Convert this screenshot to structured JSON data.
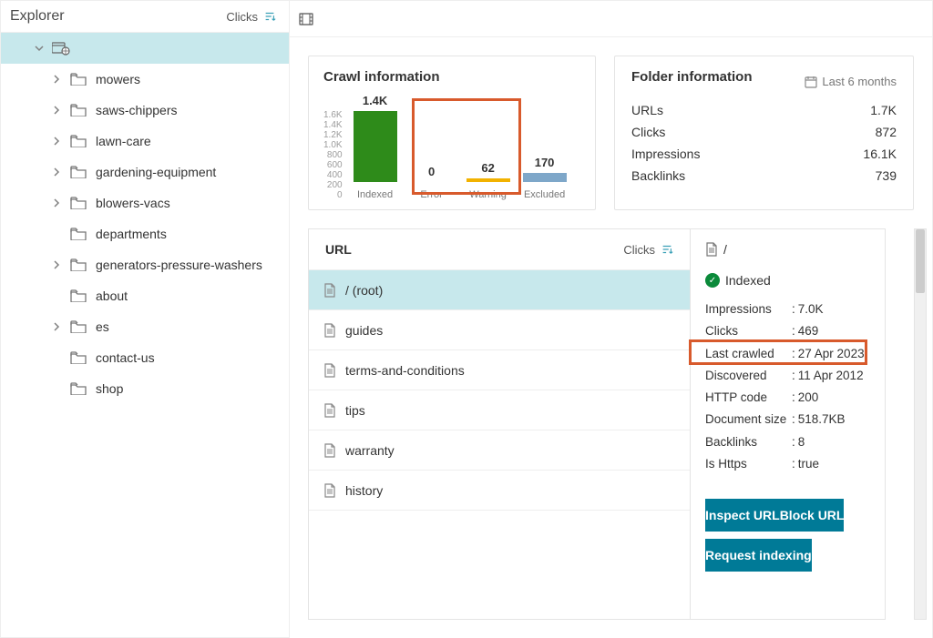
{
  "sidebar": {
    "title": "Explorer",
    "sort": "Clicks",
    "items": [
      {
        "label": "mowers",
        "expandable": true
      },
      {
        "label": "saws-chippers",
        "expandable": true
      },
      {
        "label": "lawn-care",
        "expandable": true
      },
      {
        "label": "gardening-equipment",
        "expandable": true
      },
      {
        "label": "blowers-vacs",
        "expandable": true
      },
      {
        "label": "departments",
        "expandable": false
      },
      {
        "label": "generators-pressure-washers",
        "expandable": true
      },
      {
        "label": "about",
        "expandable": false
      },
      {
        "label": "es",
        "expandable": true
      },
      {
        "label": "contact-us",
        "expandable": false
      },
      {
        "label": "shop",
        "expandable": false
      }
    ]
  },
  "crawl": {
    "title": "Crawl information",
    "yticks": [
      "1.6K",
      "1.4K",
      "1.2K",
      "1.0K",
      "800",
      "600",
      "400",
      "200",
      "0"
    ],
    "bars": [
      {
        "label": "Indexed",
        "value": "1.4K",
        "h": 78,
        "color": "#2e8b1a"
      },
      {
        "label": "Error",
        "value": "0",
        "h": 0,
        "color": "#d44"
      },
      {
        "label": "Warning",
        "value": "62",
        "h": 4,
        "color": "#f2b200"
      },
      {
        "label": "Excluded",
        "value": "170",
        "h": 10,
        "color": "#7ea7c9"
      }
    ]
  },
  "folder": {
    "title": "Folder information",
    "range": "Last 6 months",
    "rows": [
      {
        "k": "URLs",
        "v": "1.7K"
      },
      {
        "k": "Clicks",
        "v": "872"
      },
      {
        "k": "Impressions",
        "v": "16.1K"
      },
      {
        "k": "Backlinks",
        "v": "739"
      }
    ]
  },
  "urls": {
    "title": "URL",
    "sort": "Clicks",
    "rows": [
      "/ (root)",
      "guides",
      "terms-and-conditions",
      "tips",
      "warranty",
      "history"
    ],
    "selected": 0
  },
  "detail": {
    "path": "/",
    "status": "Indexed",
    "rows": [
      {
        "k": "Impressions",
        "v": "7.0K"
      },
      {
        "k": "Clicks",
        "v": "469"
      },
      {
        "k": "Last crawled",
        "v": "27 Apr 2023"
      },
      {
        "k": "Discovered",
        "v": "11 Apr 2012"
      },
      {
        "k": "HTTP code",
        "v": "200"
      },
      {
        "k": "Document size",
        "v": "518.7KB"
      },
      {
        "k": "Backlinks",
        "v": "8"
      },
      {
        "k": "Is Https",
        "v": "true"
      }
    ],
    "buttons": [
      "Inspect URL",
      "Block URL",
      "Request indexing"
    ]
  },
  "chart_data": {
    "type": "bar",
    "title": "Crawl information",
    "categories": [
      "Indexed",
      "Error",
      "Warning",
      "Excluded"
    ],
    "values": [
      1400,
      0,
      62,
      170
    ],
    "ylabel": "",
    "ylim": [
      0,
      1600
    ]
  }
}
